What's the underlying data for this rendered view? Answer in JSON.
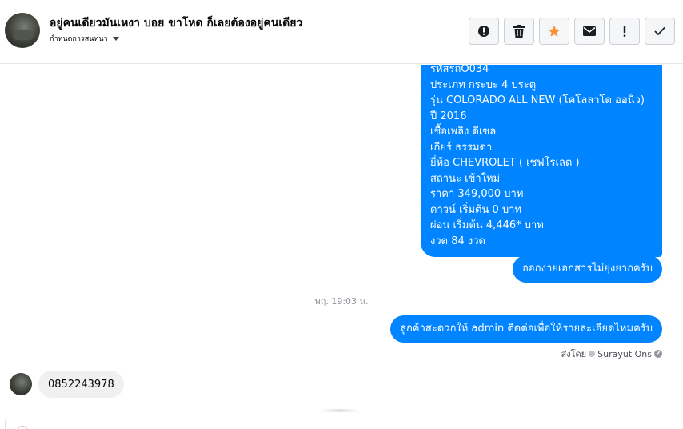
{
  "header": {
    "title": "อยู่คนเดียวมันเหงา บอย ขาโหด ก็เลยต้องอยู่คนเดียว",
    "subtitle": "กำหนดการสนทนา"
  },
  "actions": [
    {
      "name": "alert-icon"
    },
    {
      "name": "trash-icon"
    },
    {
      "name": "star-icon",
      "color": "#f7923a"
    },
    {
      "name": "envelope-icon"
    },
    {
      "name": "exclamation-icon"
    },
    {
      "name": "check-icon"
    }
  ],
  "messages": {
    "car_details": [
      "รหัสรถO034",
      "ประเภท กระบะ 4 ประตู",
      "รุ่น COLORADO ALL NEW (โคโลลาโด ออนิว)",
      "ปี 2016",
      "เชื้อเพลิง ดีเซล",
      "เกียร์ ธรรมดา",
      "ยี่ห้อ CHEVROLET ( เชฟโรเลต )",
      "สถานะ เข้าใหม่",
      "ราคา 349,000 บาท",
      "ดาวน์ เริ่มต้น 0 บาท",
      "ผ่อน เริ่มต้น 4,446* บาท",
      "งวด 84 งวด"
    ],
    "easy_docs": "ออกง่ายเอกสารไม่ยุ่งยากครับ",
    "timestamp": "พฤ. 19:03 น.",
    "admin_contact": "ลูกค้าสะดวกให้ admin ติดต่อเพื่อให้รายละเอียดไหมครับ",
    "sent_by_label": "ส่งโดย",
    "sent_by_name": "Surayut Ons",
    "help_glyph": "?",
    "customer_reply": "0852243978"
  },
  "colors": {
    "outgoing_bubble": "#0084ff",
    "incoming_bubble": "#f1f0f0"
  }
}
